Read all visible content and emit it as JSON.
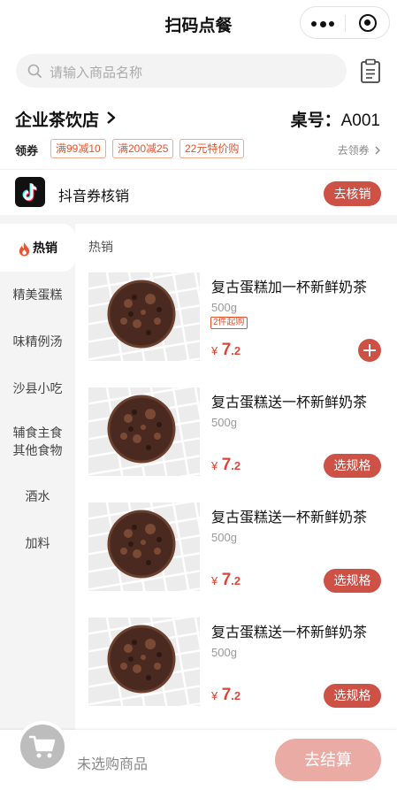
{
  "header": {
    "title": "扫码点餐"
  },
  "search": {
    "placeholder": "请输入商品名称"
  },
  "store": {
    "name": "企业茶饮店",
    "table_label": "桌号：",
    "table_no": "A001"
  },
  "coupons": {
    "label": "领券",
    "items": [
      "满99减10",
      "满200减25",
      "22元特价购"
    ],
    "get_label": "去领券"
  },
  "douyin": {
    "label": "抖音券核销",
    "button": "去核销"
  },
  "sidebar": {
    "items": [
      {
        "label": "热销"
      },
      {
        "label": "精美蛋糕"
      },
      {
        "label": "味精例汤"
      },
      {
        "label": "沙县小吃"
      },
      {
        "label": "辅食主食"
      },
      {
        "label": "其他食物"
      },
      {
        "label": "酒水"
      },
      {
        "label": "加料"
      }
    ]
  },
  "section": {
    "title": "热销"
  },
  "products": [
    {
      "name": "复古蛋糕加一杯新鲜奶茶",
      "weight": "500g",
      "limit": "2件起购",
      "currency": "¥",
      "price_int": "7",
      "price_dec": ".2",
      "action": "plus-icon"
    },
    {
      "name": "复古蛋糕送一杯新鲜奶茶",
      "weight": "500g",
      "currency": "¥",
      "price_int": "7",
      "price_dec": ".2",
      "action_label": "选规格"
    },
    {
      "name": "复古蛋糕送一杯新鲜奶茶",
      "weight": "500g",
      "currency": "¥",
      "price_int": "7",
      "price_dec": ".2",
      "action_label": "选规格"
    },
    {
      "name": "复古蛋糕送一杯新鲜奶茶",
      "weight": "500g",
      "currency": "¥",
      "price_int": "7",
      "price_dec": ".2",
      "action_label": "选规格"
    }
  ],
  "cart": {
    "empty_text": "未选购商品",
    "checkout_label": "去结算"
  },
  "colors": {
    "accent": "#cd5145",
    "price": "#d6483b",
    "coupon": "#e0532c",
    "checkout_disabled": "#e9aba4"
  }
}
